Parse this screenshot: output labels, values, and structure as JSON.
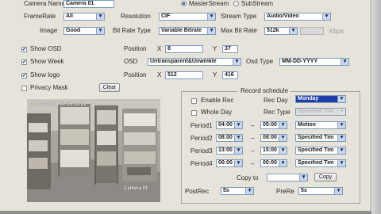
{
  "stream": {
    "camera_name_label": "Camera Name",
    "camera_name_value": "Camera 01",
    "main_stream_label": "MasterStream",
    "sub_stream_label": "SubStream",
    "frame_rate_label": "FrameRate",
    "frame_rate_value": "All",
    "resolution_label": "Resolution",
    "resolution_value": "CIF",
    "stream_type_label": "Stream Type",
    "stream_type_value": "Audio/Video",
    "image_label": "Image",
    "image_value": "Good",
    "bit_rate_type_label": "Bit Rate Type",
    "bit_rate_type_value": "Variable Bitrate",
    "max_bit_rate_label": "Max Bit Rate",
    "max_bit_rate_value": "512k",
    "kbps_label": "Kbps"
  },
  "osd": {
    "show_osd_label": "Show OSD",
    "show_week_label": "Show Week",
    "show_logo_label": "Show logo",
    "privacy_mask_label": "Privacy Mask",
    "clear_label": "Clear",
    "position_label": "Position",
    "osd_position_x": "8",
    "osd_position_y": "37",
    "x_label": "X",
    "y_label": "Y",
    "osd_label": "OSD",
    "osd_value": "Untransparent&Unwinkle",
    "osd_type_label": "Osd Type",
    "osd_type_value": "MM-DD-YYYY",
    "logo_position_x": "512",
    "logo_position_y": "416"
  },
  "record": {
    "title": "Record schedule",
    "enable_rec_label": "Enable Rec",
    "whole_day_label": "Whole Day",
    "rec_day_label": "Rec Day",
    "rec_day_value": "Monday",
    "rec_type_label": "Rec Type",
    "rec_type_value": "Specified Tim",
    "periods": [
      {
        "label": "Period1",
        "from": "04:00",
        "to": "05:00",
        "type": "Motion"
      },
      {
        "label": "Period2",
        "from": "08:00",
        "to": "08:00",
        "type": "Specified Tim"
      },
      {
        "label": "Period3",
        "from": "13:00",
        "to": "15:00",
        "type": "Specified Tim"
      },
      {
        "label": "Period4",
        "from": "00:00",
        "to": "00:00",
        "type": "Specified Tim"
      }
    ],
    "copy_to_label": "Copy to",
    "copy_to_value": "",
    "copy_button_label": "Copy",
    "post_rec_label": "PostRec",
    "post_rec_value": "5s",
    "pre_rec_label": "PreRe",
    "pre_rec_value": "5s"
  },
  "preview": {
    "timestamp": "01-27-2013 Mon 16:14:29",
    "camera_caption": "Camera 01"
  },
  "colors": {
    "dialog_bg": "#e6e3da",
    "selection": "#1f3fa8",
    "field_border": "#7f9db9"
  }
}
